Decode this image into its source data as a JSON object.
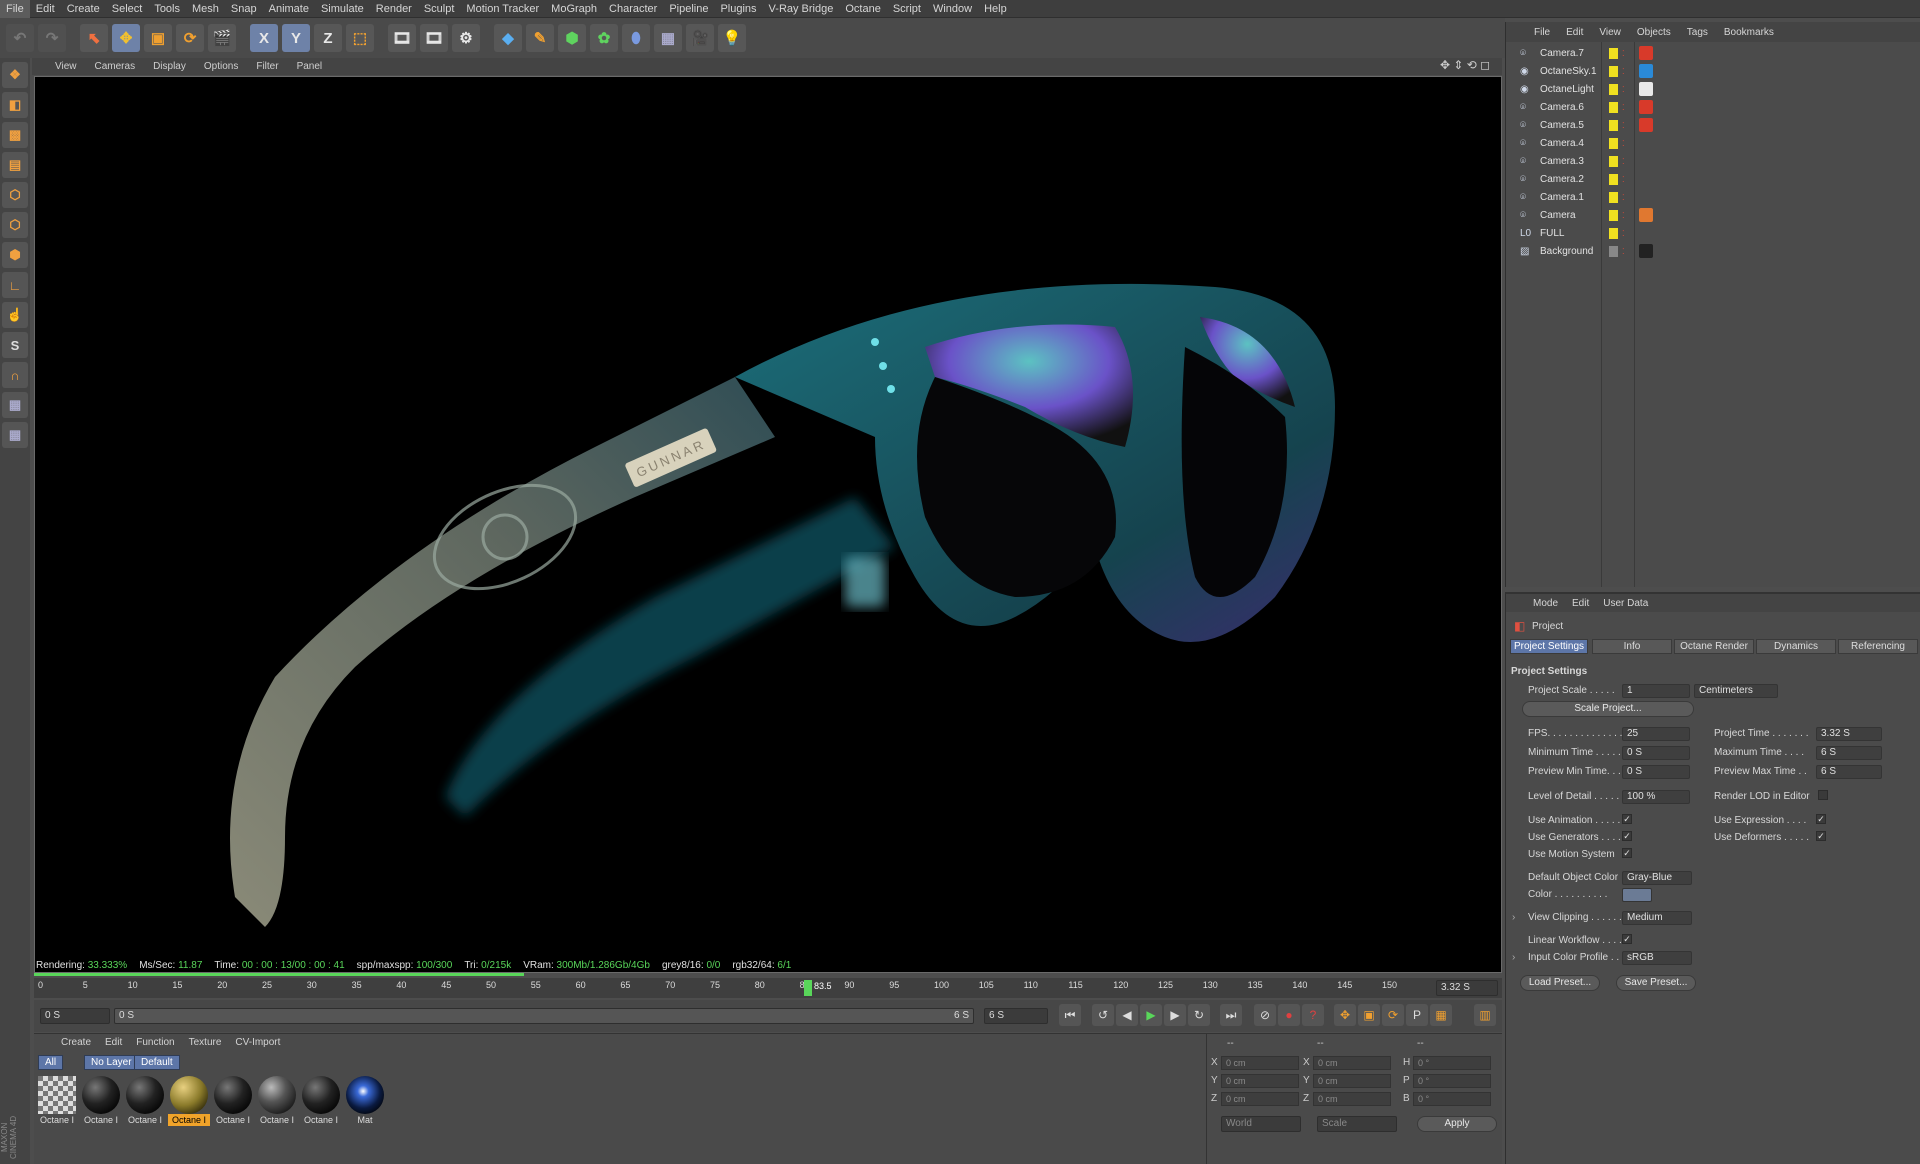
{
  "menu": [
    "File",
    "Edit",
    "Create",
    "Select",
    "Tools",
    "Mesh",
    "Snap",
    "Animate",
    "Simulate",
    "Render",
    "Sculpt",
    "Motion Tracker",
    "MoGraph",
    "Character",
    "Pipeline",
    "Plugins",
    "V-Ray Bridge",
    "Octane",
    "Script",
    "Window",
    "Help"
  ],
  "toolbar": {
    "x_label": "X",
    "y_label": "Y",
    "z_label": "Z"
  },
  "viewport_menu": [
    "View",
    "Cameras",
    "Display",
    "Options",
    "Filter",
    "Panel"
  ],
  "render_text": {
    "brand": "GUNNAR"
  },
  "status": {
    "rendering_label": "Rendering:",
    "rendering_val": "33.333%",
    "ms_label": "Ms/Sec:",
    "ms_val": "11.87",
    "time_label": "Time:",
    "time_val": "00 : 00 : 13/00 : 00 : 41",
    "spp_label": "spp/maxspp:",
    "spp_val": "100/300",
    "tri_label": "Tri:",
    "tri_val": "0/215k",
    "vram_label": "VRam:",
    "vram_val": "300Mb/1.286Gb/4Gb",
    "grey_label": "grey8/16:",
    "grey_val": "0/0",
    "rgb_label": "rgb32/64:",
    "rgb_val": "6/1"
  },
  "timeline": {
    "ticks": [
      "0",
      "5",
      "10",
      "15",
      "20",
      "25",
      "30",
      "35",
      "40",
      "45",
      "50",
      "55",
      "60",
      "65",
      "70",
      "75",
      "80",
      "85",
      "90",
      "95",
      "100",
      "105",
      "110",
      "115",
      "120",
      "125",
      "130",
      "135",
      "140",
      "145",
      "150"
    ],
    "current_frame": "83.5",
    "current_time": "3.32 S"
  },
  "transport": {
    "start_field": "0 S",
    "range_start": "0 S",
    "range_end": "6 S",
    "end_field": "6 S"
  },
  "material_menu": [
    "Create",
    "Edit",
    "Function",
    "Texture",
    "CV-Import"
  ],
  "material_tabs": [
    "All",
    "No Layer",
    "Default"
  ],
  "materials": [
    {
      "name": "Octane I",
      "kind": "checker"
    },
    {
      "name": "Octane I",
      "kind": "dark"
    },
    {
      "name": "Octane I",
      "kind": "dark"
    },
    {
      "name": "Octane I",
      "kind": "gold",
      "selected": true
    },
    {
      "name": "Octane I",
      "kind": "dark"
    },
    {
      "name": "Octane I",
      "kind": "glass"
    },
    {
      "name": "Octane I",
      "kind": "dark"
    },
    {
      "name": "Mat",
      "kind": "blue"
    }
  ],
  "coords": {
    "headers": [
      "--",
      "--",
      "--"
    ],
    "rows": [
      {
        "a": "X",
        "av": "0 cm",
        "b": "X",
        "bv": "0 cm",
        "c": "H",
        "cv": "0 °"
      },
      {
        "a": "Y",
        "av": "0 cm",
        "b": "Y",
        "bv": "0 cm",
        "c": "P",
        "cv": "0 °"
      },
      {
        "a": "Z",
        "av": "0 cm",
        "b": "Z",
        "bv": "0 cm",
        "c": "B",
        "cv": "0 °"
      }
    ],
    "world": "World",
    "scale": "Scale",
    "apply": "Apply"
  },
  "object_menu": [
    "File",
    "Edit",
    "View",
    "Objects",
    "Tags",
    "Bookmarks"
  ],
  "objects": [
    {
      "name": "Camera.7",
      "tag": "red"
    },
    {
      "name": "OctaneSky.1",
      "tag": "blue"
    },
    {
      "name": "OctaneLight",
      "tag": "white"
    },
    {
      "name": "Camera.6",
      "tag": "red"
    },
    {
      "name": "Camera.5",
      "tag": "red"
    },
    {
      "name": "Camera.4",
      "tag": ""
    },
    {
      "name": "Camera.3",
      "tag": ""
    },
    {
      "name": "Camera.2",
      "tag": ""
    },
    {
      "name": "Camera.1",
      "tag": ""
    },
    {
      "name": "Camera",
      "tag": "orange"
    },
    {
      "name": "FULL",
      "tag": ""
    },
    {
      "name": "Background",
      "tag": "dark"
    }
  ],
  "attr_menu": [
    "Mode",
    "Edit",
    "User Data"
  ],
  "attr": {
    "object": "Project",
    "tabs": [
      "Project Settings",
      "Info",
      "Octane Render",
      "Dynamics",
      "Referencing"
    ],
    "section": "Project Settings",
    "project_scale_label": "Project Scale . . . . .",
    "project_scale_val": "1",
    "project_scale_unit": "Centimeters",
    "scale_project_btn": "Scale Project...",
    "fps_label": "FPS. . . . . . . . . . . . . .",
    "fps_val": "25",
    "project_time_label": "Project Time . . . . . . .",
    "project_time_val": "3.32 S",
    "min_time_label": "Minimum Time . . . . .",
    "min_time_val": "0 S",
    "max_time_label": "Maximum Time . . . .",
    "max_time_val": "6 S",
    "prev_min_label": "Preview Min Time. . .",
    "prev_min_val": "0 S",
    "prev_max_label": "Preview Max Time . .",
    "prev_max_val": "6 S",
    "lod_label": "Level of Detail . . . . .",
    "lod_val": "100 %",
    "render_lod_label": "Render LOD in Editor",
    "use_anim_label": "Use Animation . . . . .",
    "use_expr_label": "Use Expression . . . .",
    "use_gen_label": "Use Generators . . . .",
    "use_def_label": "Use Deformers . . . . .",
    "use_motion_label": "Use Motion System",
    "def_color_label": "Default Object Color",
    "def_color_val": "Gray-Blue",
    "color_label": "Color . . . . . . . . . .",
    "view_clip_label": "View Clipping . . . . . .",
    "view_clip_val": "Medium",
    "linear_label": "Linear Workflow . . . .",
    "input_profile_label": "Input Color Profile . . .",
    "input_profile_val": "sRGB",
    "load_preset": "Load Preset...",
    "save_preset": "Save Preset..."
  },
  "logo": "MAXON CINEMA 4D",
  "colors": {
    "accent": "#5d76a8",
    "highlight": "#f0a32a",
    "status_green": "#59d65a"
  }
}
